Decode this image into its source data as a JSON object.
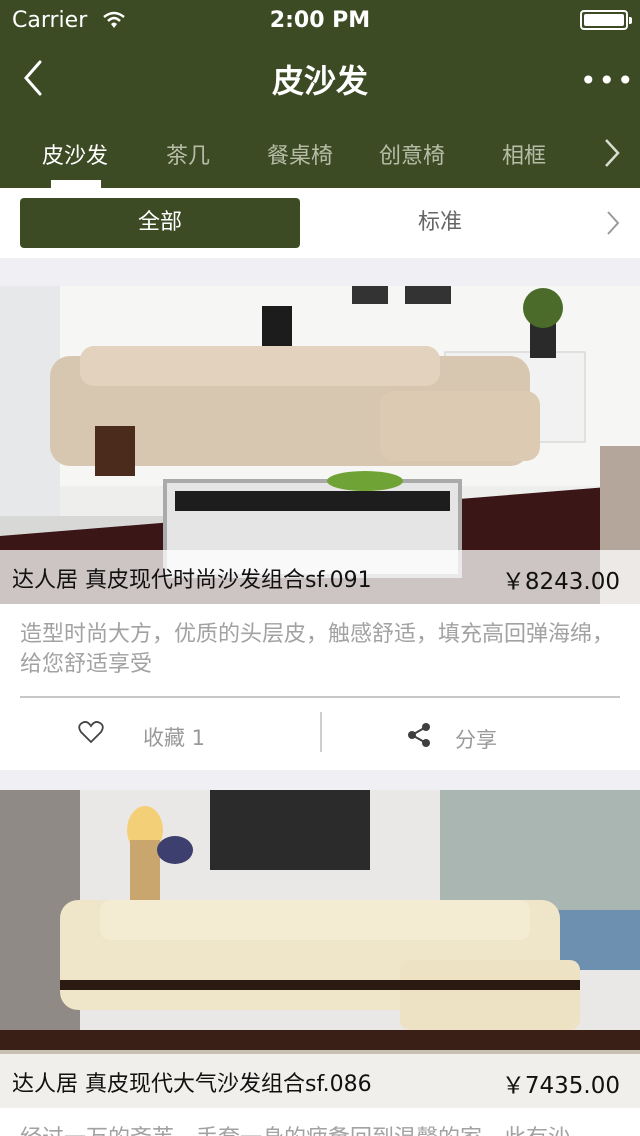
{
  "status_bar": {
    "carrier": "Carrier",
    "time": "2:00 PM"
  },
  "navbar": {
    "title": "皮沙发",
    "more": "•••"
  },
  "tabs": [
    {
      "label": "皮沙发",
      "active": true
    },
    {
      "label": "茶几"
    },
    {
      "label": "餐桌椅"
    },
    {
      "label": "创意椅"
    },
    {
      "label": "相框"
    }
  ],
  "filter": {
    "all_label": "全部",
    "standard_label": "标准"
  },
  "products": [
    {
      "name": "达人居 真皮现代时尚沙发组合sf.091",
      "price": "￥8243.00",
      "description": "造型时尚大方，优质的头层皮，触感舒适，填充高回弹海绵，给您舒适享受",
      "favorite_label": "收藏 1",
      "share_label": "分享"
    },
    {
      "name": "达人居 真皮现代大气沙发组合sf.086",
      "price": "￥7435.00",
      "description": "经过一万的斋芙，手套一身的疲惫回到温馨的家，此有沙"
    }
  ],
  "colors": {
    "brand": "#3d4b24",
    "background": "#efeff4"
  }
}
